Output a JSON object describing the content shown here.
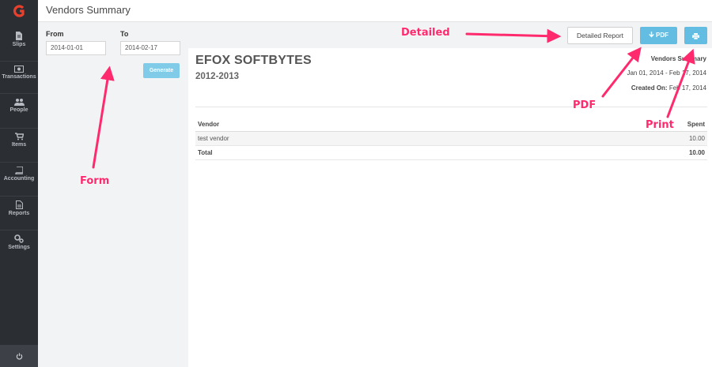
{
  "app": {
    "logo_letter": "G",
    "accent_color": "#e8402c"
  },
  "sidebar": {
    "items": [
      {
        "label": "Slips",
        "icon": "document-icon"
      },
      {
        "label": "Transactions",
        "icon": "money-icon"
      },
      {
        "label": "People",
        "icon": "people-icon"
      },
      {
        "label": "Items",
        "icon": "cart-icon"
      },
      {
        "label": "Accounting",
        "icon": "book-icon"
      },
      {
        "label": "Reports",
        "icon": "report-icon"
      },
      {
        "label": "Settings",
        "icon": "gears-icon"
      }
    ],
    "power_icon": "power-icon"
  },
  "header": {
    "title": "Vendors Summary"
  },
  "form": {
    "from_label": "From",
    "from_value": "2014-01-01",
    "to_label": "To",
    "to_value": "2014-02-17",
    "generate_label": "Generate"
  },
  "toolbar": {
    "detailed_label": "Detailed Report",
    "pdf_label": "PDF",
    "print_icon": "print-icon"
  },
  "report": {
    "company": "EFOX SOFTBYTES",
    "year": "2012-2013",
    "title": "Vendors Summary",
    "range": "Jan 01, 2014 - Feb 17, 2014",
    "created_label": "Created On:",
    "created_value": "Feb 17, 2014",
    "columns": [
      "Vendor",
      "Spent"
    ],
    "rows": [
      {
        "vendor": "test vendor",
        "spent": "10.00"
      }
    ],
    "total_label": "Total",
    "total_value": "10.00"
  },
  "annotations": {
    "detailed": "Detailed",
    "pdf": "PDF",
    "print": "Print",
    "form": "Form",
    "color": "#ff2a6d"
  }
}
